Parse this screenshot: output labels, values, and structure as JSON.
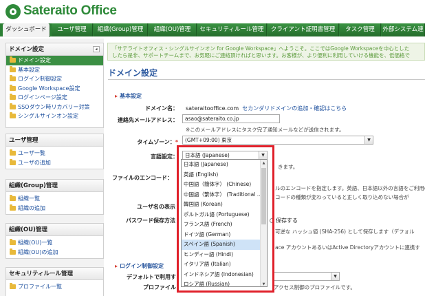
{
  "app": {
    "logo_text": "Sateraito Office"
  },
  "tabs": [
    {
      "label": "ダッシュボード",
      "active": true
    },
    {
      "label": "ユーザ管理"
    },
    {
      "label": "組織(Group)管理"
    },
    {
      "label": "組織(OU)管理"
    },
    {
      "label": "セキュリティルール管理"
    },
    {
      "label": "クライアント証明書管理"
    },
    {
      "label": "タスク管理"
    },
    {
      "label": "外部システム連"
    }
  ],
  "sidebar": {
    "domain": {
      "title": "ドメイン設定",
      "collapse": "◂",
      "items": [
        "ドメイン設定",
        "基本設定",
        "ログイン制御設定",
        "Google Workspace設定",
        "ログインページ設定",
        "SSOダウン時リカバリー対策",
        "シングルサインオン設定"
      ]
    },
    "users": {
      "title": "ユーザ管理",
      "items": [
        "ユーザ一覧",
        "ユーザの追加"
      ]
    },
    "groups": {
      "title": "組織(Group)管理",
      "items": [
        "組織一覧",
        "組織の追加"
      ]
    },
    "ous": {
      "title": "組織(OU)管理",
      "items": [
        "組織(OU)一覧",
        "組織(OU)の追加"
      ]
    },
    "security": {
      "title": "セキュリティルール管理",
      "items": [
        "プロファイル一覧"
      ]
    }
  },
  "notice": {
    "line1": "「サテライトオフィス・シングルサインオン for Google Workspace」へようこそ。ここではGoogle Workspaceを中心とした",
    "line2": "したら是非、サポートチームまで、お気軽にご連絡頂ければと思います。お客様が、より便利に利用していける機能を、低価格で"
  },
  "main": {
    "page_title": "ドメイン設定",
    "basic_section": "基本設定",
    "domain_label": "ドメイン名：",
    "domain_value": "sateraitooffice.com",
    "domain_links": "セカンダリドメインの追加・確認はこちら",
    "email_label": "連絡先メールアドレス：",
    "email_value": "asao@sateraito.co.jp",
    "email_note": "※このメールアドレスにタスク完了通知メールなどが送信されます。",
    "timezone_label": "タイムゾーン：",
    "timezone_value": "(GMT+09:00) 東京",
    "language_label": "言語設定：",
    "language_value": "日本語 (Japanese)",
    "language_note": "きます。",
    "encoding_label": "ファイルのエンコード：",
    "encoding_note1": "ルのエンコードを指定します。英語、日本語以外の言語をご利用の",
    "encoding_note2": "コードの種類が変わっていると正しく取り込めない場合が",
    "username_label": "ユーザ名の表示",
    "password_label": "パスワード保存方法",
    "password_opt": "保存する",
    "password_note1": "可逆な ハッシュ値 (SHA-256) として保存します（デフォル",
    "password_note2": "ace アカウントあるいはActive Directoryアカウントに連携す",
    "login_section": "ログイン制御設定",
    "default_label": "デフォルトで利用す",
    "profile_label": "プロファイル",
    "profile_note": "アクセス制御のプロファイルです。"
  },
  "language_options": [
    "日本語 (Japanese)",
    "英語 (English)",
    "中国語（簡体字） (Chinese)",
    "中国語（繁体字） (Traditional ...",
    "韓国語 (Korean)",
    "ポルトガル語 (Portuguese)",
    "フランス語 (French)",
    "ドイツ語 (German)",
    "スペイン語 (Spanish)",
    "ヒンディー語 (Hindi)",
    "イタリア語 (Italian)",
    "インドネシア語 (Indonesian)",
    "ロシア語 (Russian)"
  ],
  "language_hover_index": 8
}
